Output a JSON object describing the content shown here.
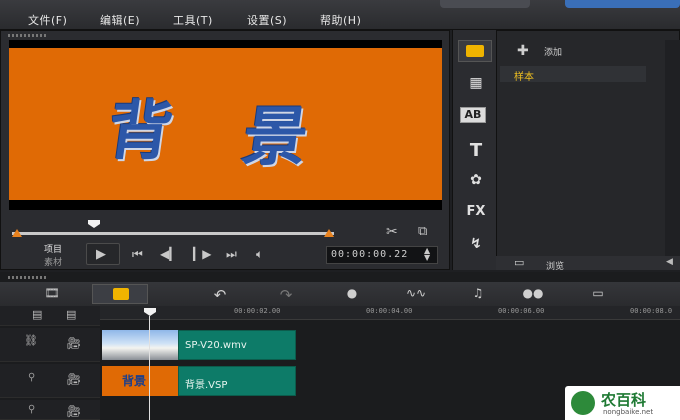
{
  "menu": [
    "文件(F)",
    "编辑(E)",
    "工具(T)",
    "设置(S)",
    "帮助(H)"
  ],
  "preview": {
    "title_chars": [
      "背",
      "景"
    ],
    "mode_project": "项目",
    "mode_clip": "素材",
    "timecode": "00:00:00.22"
  },
  "library": {
    "add_label": "添加",
    "item": "样本",
    "browse_label": "浏览",
    "tools": [
      "FX"
    ]
  },
  "timeline": {
    "ruler": [
      "00:00:02.00",
      "00:00:04.00",
      "00:00:06.00",
      "00:00:08.0"
    ],
    "clips": [
      {
        "label": "SP-V20.wmv"
      },
      {
        "label": "背景.VSP"
      }
    ],
    "thumb_text": "背景"
  },
  "watermark": {
    "text": "农百科",
    "url": "nongbaike.net"
  }
}
